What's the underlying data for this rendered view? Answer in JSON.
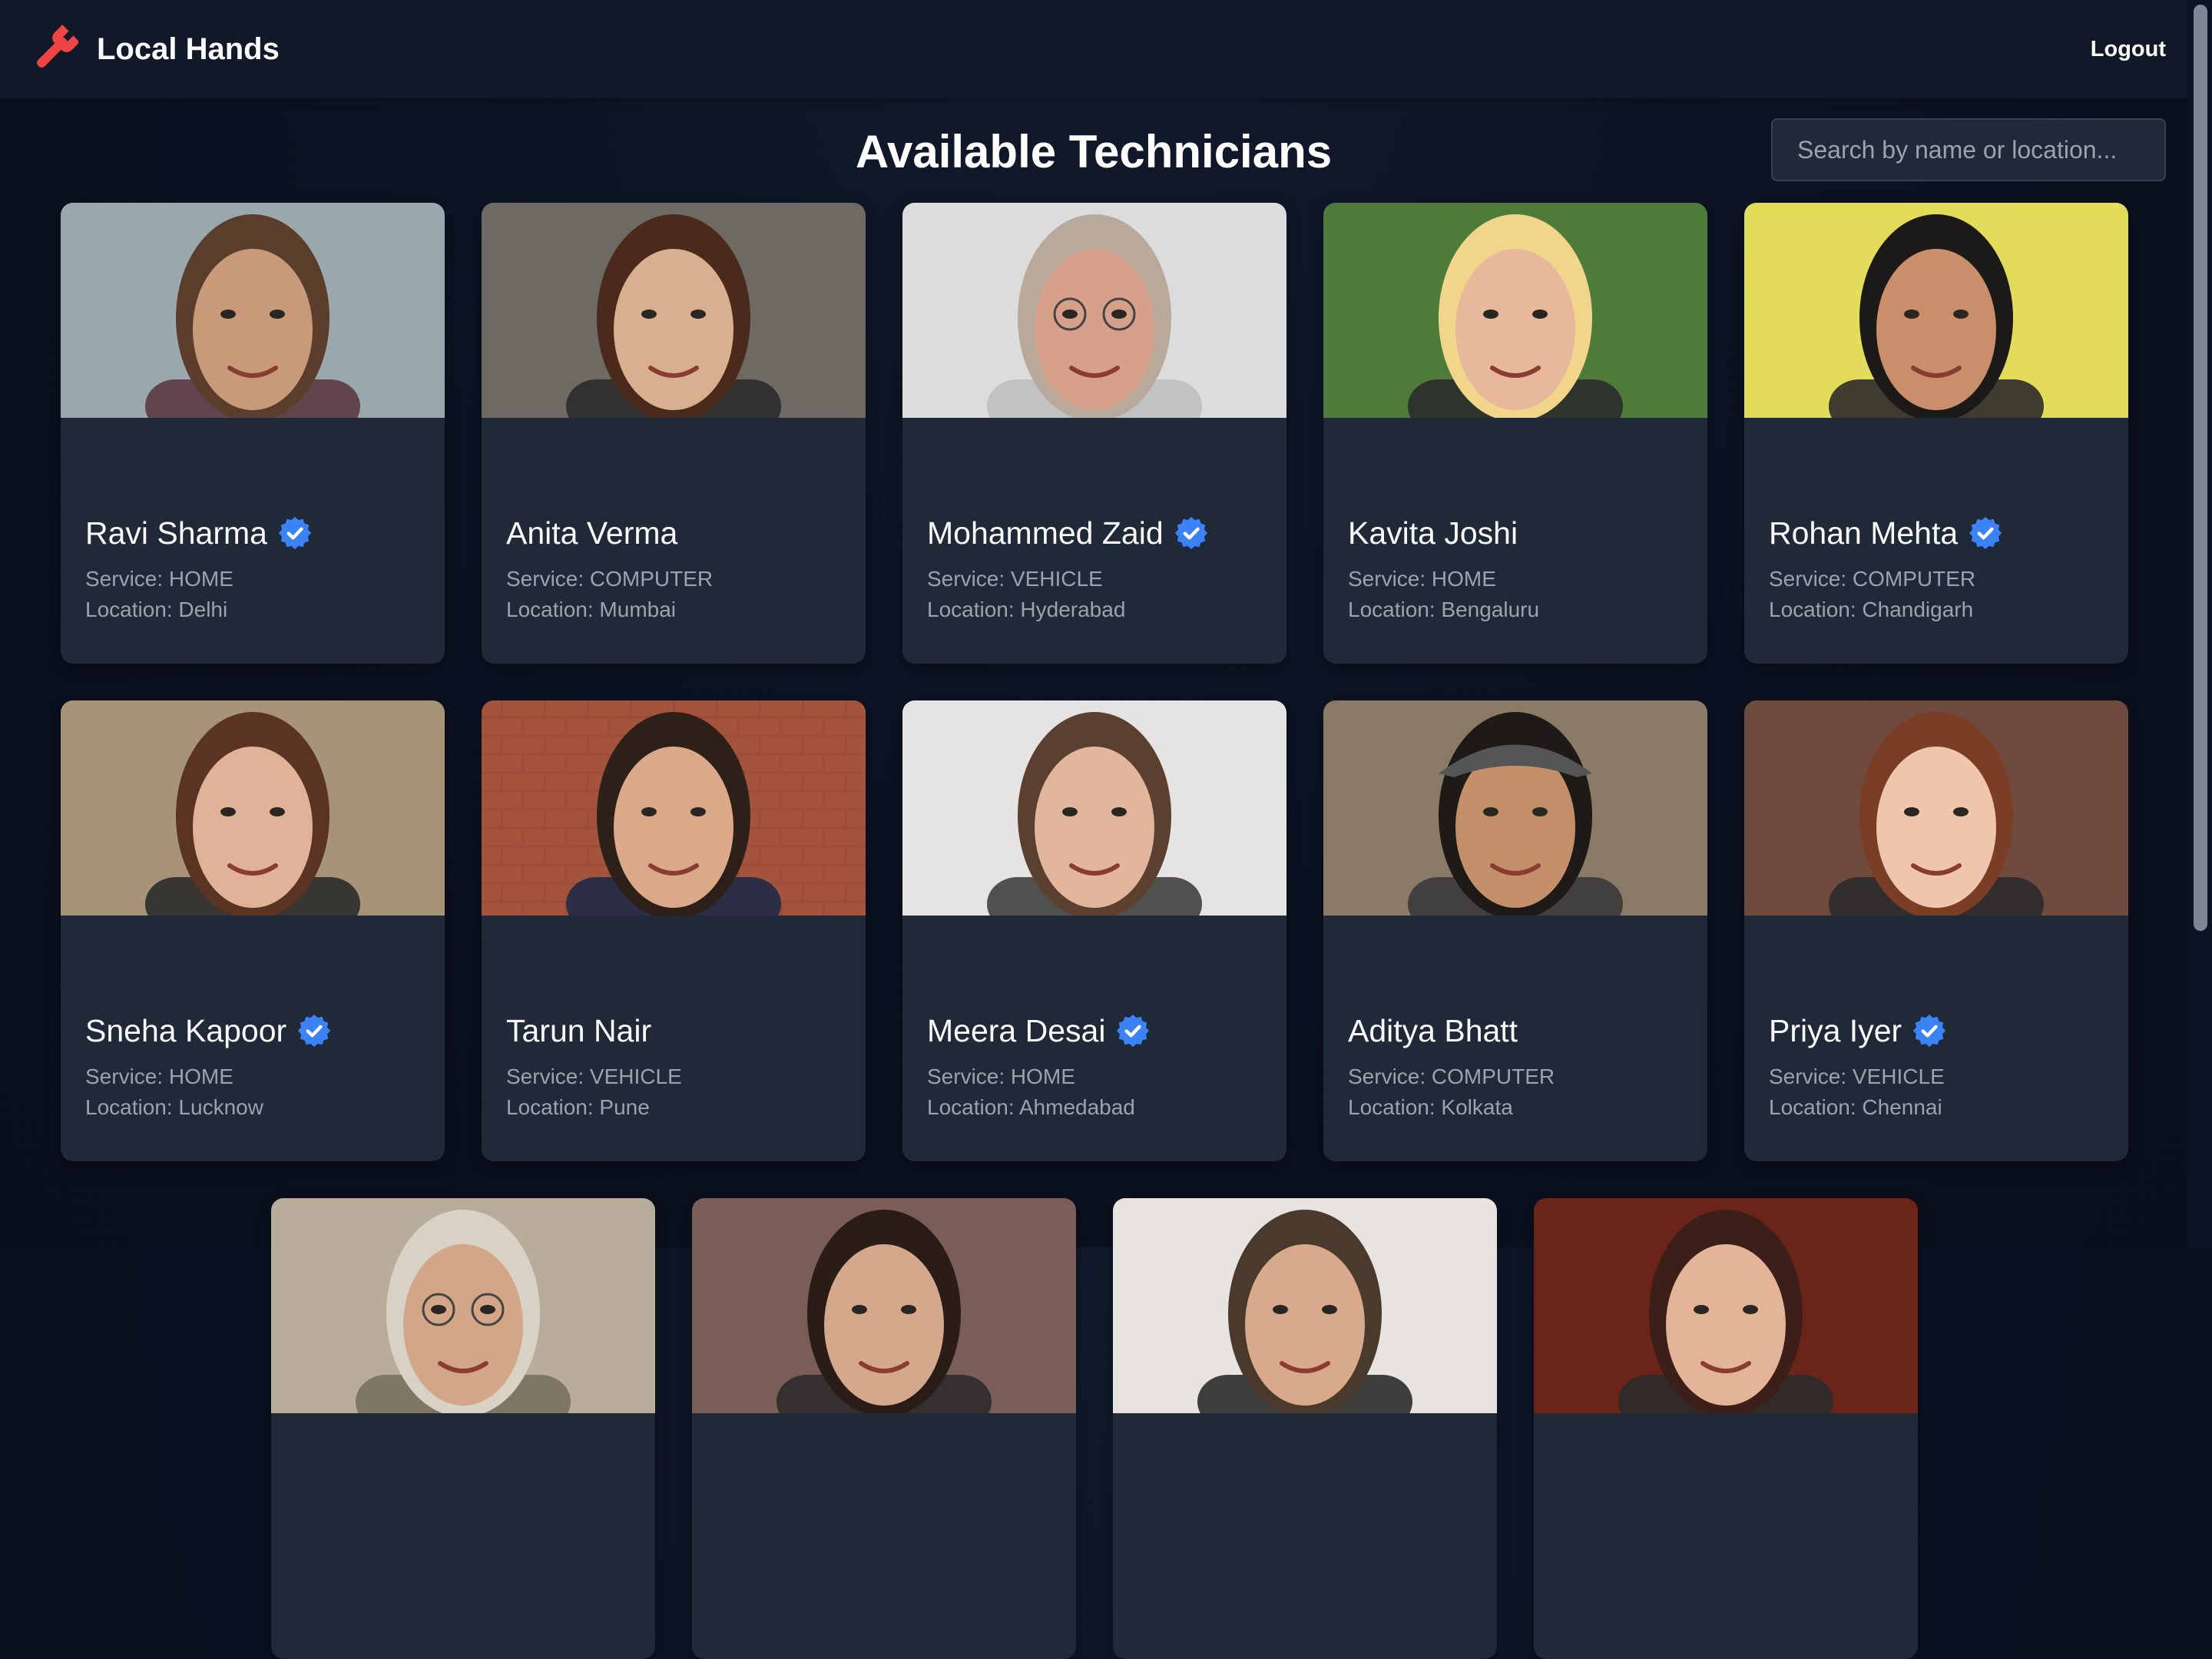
{
  "app": {
    "name": "Local Hands",
    "logout_label": "Logout",
    "accent": "#ef4444"
  },
  "page": {
    "title": "Available Technicians",
    "search_placeholder": "Search by name or location...",
    "verified_color": "#3b82f6",
    "technicians": [
      {
        "name": "Ravi Sharma",
        "verified": true,
        "service": "Service: HOME",
        "location": "Location: Delhi",
        "photo": "man-beard-outdoor"
      },
      {
        "name": "Anita Verma",
        "verified": false,
        "service": "Service: COMPUTER",
        "location": "Location: Mumbai",
        "photo": "woman-smiling-tree"
      },
      {
        "name": "Mohammed Zaid",
        "verified": true,
        "service": "Service: VEHICLE",
        "location": "Location: Hyderabad",
        "photo": "older-man-glasses"
      },
      {
        "name": "Kavita Joshi",
        "verified": false,
        "service": "Service: HOME",
        "location": "Location: Bengaluru",
        "photo": "blonde-woman-leaves"
      },
      {
        "name": "Rohan Mehta",
        "verified": true,
        "service": "Service: COMPUTER",
        "location": "Location: Chandigarh",
        "photo": "man-yellow-background"
      },
      {
        "name": "Sneha Kapoor",
        "verified": true,
        "service": "Service: HOME",
        "location": "Location: Lucknow",
        "photo": "woman-city-background"
      },
      {
        "name": "Tarun Nair",
        "verified": false,
        "service": "Service: VEHICLE",
        "location": "Location: Pune",
        "photo": "man-brick-wall"
      },
      {
        "name": "Meera Desai",
        "verified": true,
        "service": "Service: HOME",
        "location": "Location: Ahmedabad",
        "photo": "woman-plain-background"
      },
      {
        "name": "Aditya Bhatt",
        "verified": false,
        "service": "Service: COMPUTER",
        "location": "Location: Kolkata",
        "photo": "man-hat-smiling"
      },
      {
        "name": "Priya Iyer",
        "verified": true,
        "service": "Service: VEHICLE",
        "location": "Location: Chennai",
        "photo": "woman-red-hair-smiling"
      },
      {
        "name": "",
        "verified": false,
        "service": "",
        "location": "",
        "photo": "man-glasses-partial"
      },
      {
        "name": "",
        "verified": false,
        "service": "",
        "location": "",
        "photo": "woman-dark-hair-partial"
      },
      {
        "name": "",
        "verified": false,
        "service": "",
        "location": "",
        "photo": "man-short-hair-partial"
      },
      {
        "name": "",
        "verified": false,
        "service": "",
        "location": "",
        "photo": "woman-red-background-partial"
      }
    ]
  }
}
